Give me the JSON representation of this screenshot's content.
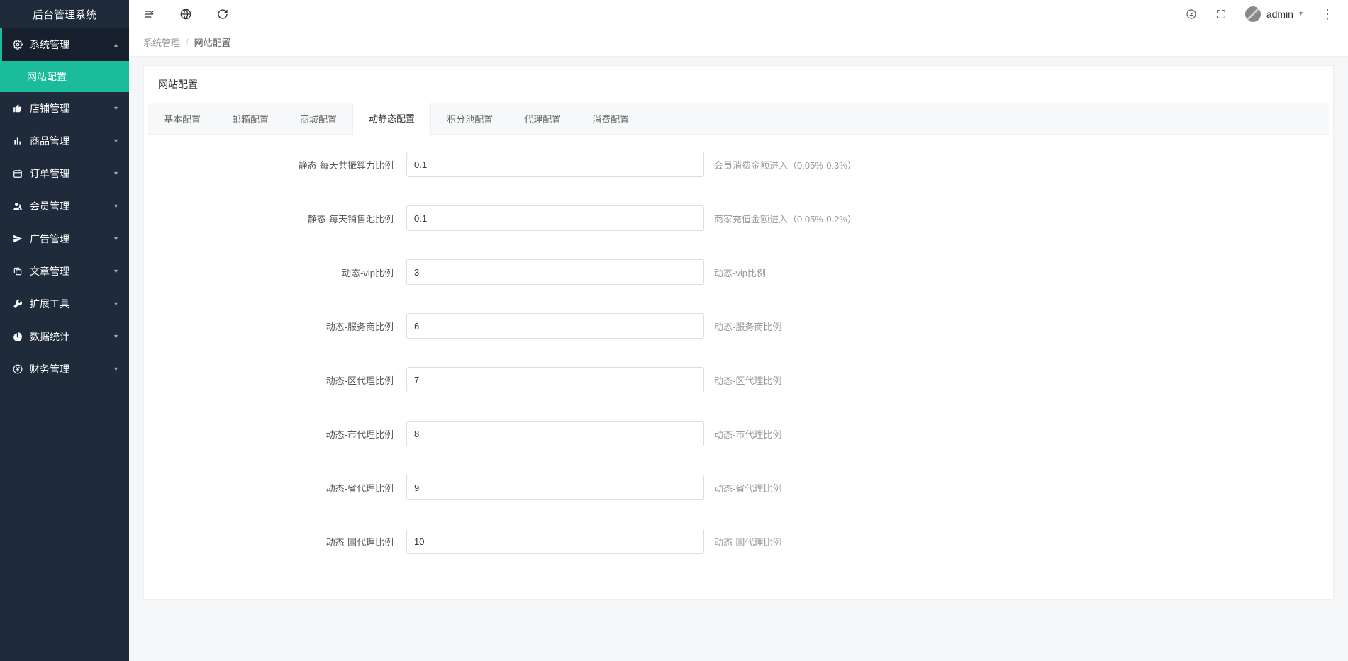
{
  "app": {
    "title": "后台管理系统"
  },
  "sidebar": {
    "groups": [
      {
        "label": "系统管理",
        "icon": "gear",
        "expanded": true,
        "items": [
          {
            "label": "网站配置",
            "active": true
          }
        ]
      },
      {
        "label": "店铺管理",
        "icon": "thumb"
      },
      {
        "label": "商品管理",
        "icon": "chart"
      },
      {
        "label": "订单管理",
        "icon": "calendar"
      },
      {
        "label": "会员管理",
        "icon": "users"
      },
      {
        "label": "广告管理",
        "icon": "send"
      },
      {
        "label": "文章管理",
        "icon": "copy"
      },
      {
        "label": "扩展工具",
        "icon": "wrench"
      },
      {
        "label": "数据统计",
        "icon": "pie"
      },
      {
        "label": "财务管理",
        "icon": "yen"
      }
    ]
  },
  "topbar": {
    "user": "admin"
  },
  "breadcrumb": {
    "a": "系统管理",
    "b": "网站配置"
  },
  "page": {
    "title": "网站配置",
    "tabs": [
      {
        "label": "基本配置"
      },
      {
        "label": "邮箱配置"
      },
      {
        "label": "商城配置"
      },
      {
        "label": "动静态配置",
        "active": true
      },
      {
        "label": "积分池配置"
      },
      {
        "label": "代理配置"
      },
      {
        "label": "消费配置"
      }
    ],
    "form": [
      {
        "label": "静态-每天共振算力比例",
        "value": "0.1",
        "hint": "会员消费金额进入（0.05%-0.3%）"
      },
      {
        "label": "静态-每天销售池比例",
        "value": "0.1",
        "hint": "商家充值金额进入（0.05%-0.2%）"
      },
      {
        "label": "动态-vip比例",
        "value": "3",
        "hint": "动态-vip比例"
      },
      {
        "label": "动态-服务商比例",
        "value": "6",
        "hint": "动态-服务商比例"
      },
      {
        "label": "动态-区代理比例",
        "value": "7",
        "hint": "动态-区代理比例"
      },
      {
        "label": "动态-市代理比例",
        "value": "8",
        "hint": "动态-市代理比例"
      },
      {
        "label": "动态-省代理比例",
        "value": "9",
        "hint": "动态-省代理比例"
      },
      {
        "label": "动态-国代理比例",
        "value": "10",
        "hint": "动态-国代理比例"
      }
    ]
  }
}
